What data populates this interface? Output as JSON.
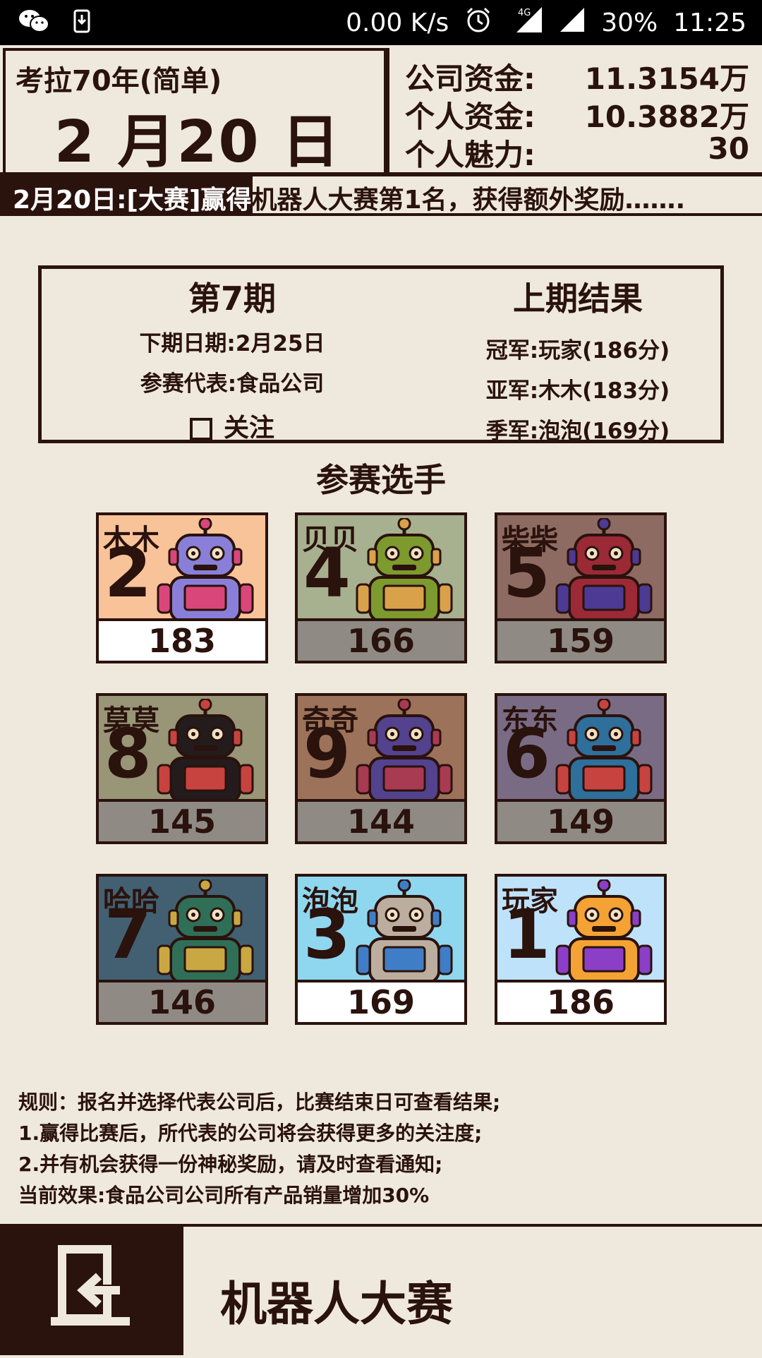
{
  "status_bar": {
    "speed": "0.00 K/s",
    "network": "4G",
    "battery": "30%",
    "time": "11:25"
  },
  "header": {
    "game_title": "考拉70年(简单)",
    "date": "2 月20 日",
    "stats": [
      {
        "label": "公司资金:",
        "value": "11.3154万"
      },
      {
        "label": "个人资金:",
        "value": "10.3882万"
      },
      {
        "label": "个人魅力:",
        "value": "30"
      }
    ]
  },
  "ticker": {
    "highlight": "2月20日:[大赛]赢得",
    "text": "机器人大赛第1名，获得额外奖励……."
  },
  "panel": {
    "issue": "第7期",
    "next_date": "下期日期:2月25日",
    "representative": "参赛代表:食品公司",
    "follow_label": "关注",
    "last_title": "上期结果",
    "results": [
      "冠军:玩家(186分)",
      "亚军:木木(183分)",
      "季军:泡泡(169分)"
    ]
  },
  "section_title": "参赛选手",
  "contestants": [
    {
      "name": "木木",
      "number": "2",
      "score": "183",
      "bg": "#f9c39a",
      "score_bg": "#ffffff",
      "robot": "purple-screen-robot",
      "body": "#8a7fd8",
      "accent": "#d9477a"
    },
    {
      "name": "贝贝",
      "number": "4",
      "score": "166",
      "bg": "#a7b08f",
      "score_bg": "#8f8a84",
      "robot": "green-dome-robot",
      "body": "#7d9a2e",
      "accent": "#d9a24a"
    },
    {
      "name": "柴柴",
      "number": "5",
      "score": "159",
      "bg": "#8e6b62",
      "score_bg": "#8f8a84",
      "robot": "red-dome-robot",
      "body": "#9b2a36",
      "accent": "#4c3a94"
    },
    {
      "name": "莫莫",
      "number": "8",
      "score": "145",
      "bg": "#999577",
      "score_bg": "#8f8a84",
      "robot": "black-devil-robot",
      "body": "#241c1c",
      "accent": "#c7433f"
    },
    {
      "name": "奇奇",
      "number": "9",
      "score": "144",
      "bg": "#9c735a",
      "score_bg": "#8f8a84",
      "robot": "purple-screen-robot",
      "body": "#53428e",
      "accent": "#a83a52"
    },
    {
      "name": "东东",
      "number": "6",
      "score": "149",
      "bg": "#7a6b84",
      "score_bg": "#8f8a84",
      "robot": "blue-robot",
      "body": "#2e6f9b",
      "accent": "#c7433f"
    },
    {
      "name": "哈哈",
      "number": "7",
      "score": "146",
      "bg": "#426072",
      "score_bg": "#8f8a84",
      "robot": "green-antenna-robot",
      "body": "#2f6f57",
      "accent": "#c9a844"
    },
    {
      "name": "泡泡",
      "number": "3",
      "score": "169",
      "bg": "#8fd7ef",
      "score_bg": "#ffffff",
      "robot": "gray-teeth-robot",
      "body": "#bcae9f",
      "accent": "#3f7ec7"
    },
    {
      "name": "玩家",
      "number": "1",
      "score": "186",
      "bg": "#bfe2fb",
      "score_bg": "#ffffff",
      "robot": "orange-player-robot",
      "body": "#f4a234",
      "accent": "#8b3fc7"
    }
  ],
  "rules": [
    "规则：报名并选择代表公司后，比赛结束日可查看结果;",
    "1.赢得比赛后，所代表的公司将会获得更多的关注度;",
    "2.并有机会获得一份神秘奖励，请及时查看通知;",
    "当前效果:食品公司公司所有产品销量增加30%"
  ],
  "footer": {
    "title": "机器人大赛"
  }
}
